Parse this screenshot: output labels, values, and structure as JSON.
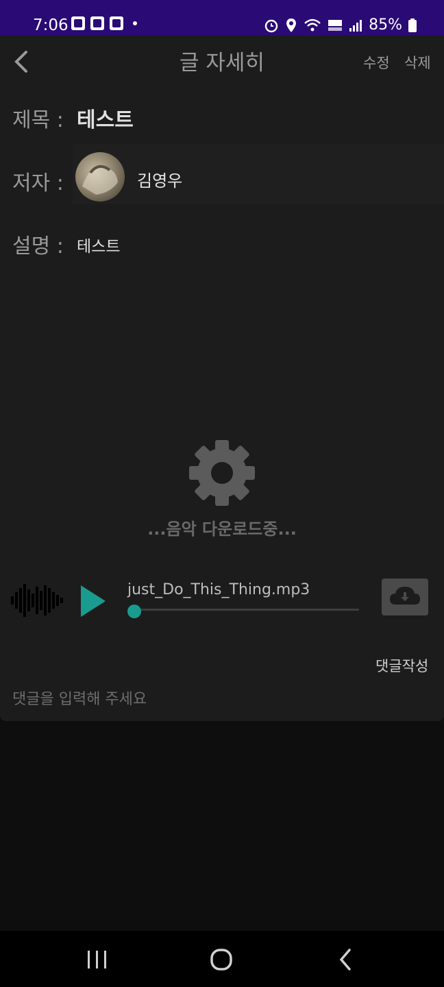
{
  "status": {
    "time": "7:06",
    "battery": "85%"
  },
  "header": {
    "title": "글 자세히",
    "edit_label": "수정",
    "delete_label": "삭제"
  },
  "post": {
    "title_label": "제목 :",
    "title_value": "테스트",
    "author_label": "저자 :",
    "author_name": "김영우",
    "desc_label": "설명 :",
    "desc_value": "테스트"
  },
  "loading": {
    "text": "...음악 다운로드중..."
  },
  "player": {
    "filename": "just_Do_This_Thing.mp3",
    "progress": 0.0
  },
  "comments": {
    "write_label": "댓글작성",
    "input_placeholder": "댓글을 입력해 주세요"
  },
  "colors": {
    "status_bar": "#2a0a74",
    "accent": "#1a9b8f",
    "panel": "#1c1c1c"
  }
}
